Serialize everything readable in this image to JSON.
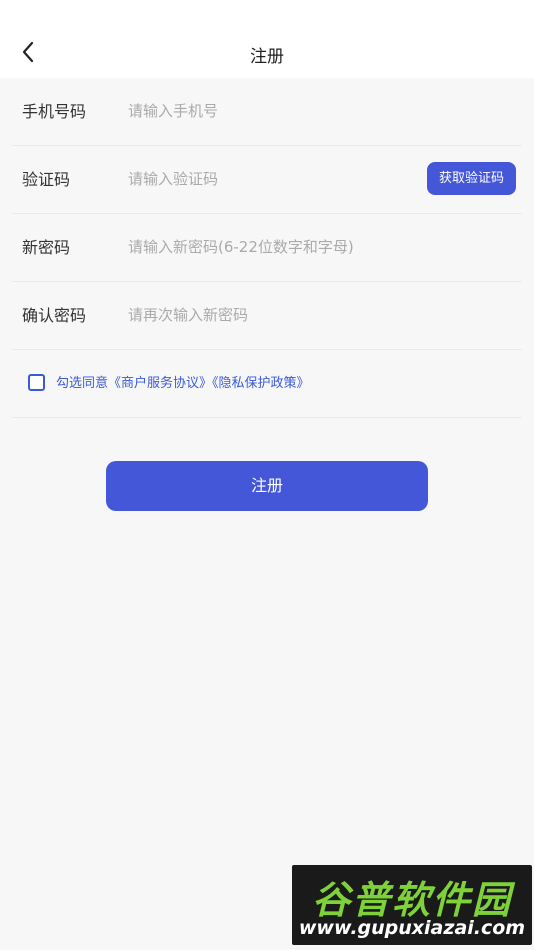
{
  "header": {
    "title": "注册",
    "back_icon": "chevron-left-icon"
  },
  "form": {
    "phone": {
      "label": "手机号码",
      "placeholder": "请输入手机号"
    },
    "code": {
      "label": "验证码",
      "placeholder": "请输入验证码",
      "button": "获取验证码"
    },
    "new_password": {
      "label": "新密码",
      "placeholder": "请输入新密码(6-22位数字和字母)"
    },
    "confirm_password": {
      "label": "确认密码",
      "placeholder": "请再次输入新密码"
    }
  },
  "agreement": {
    "checked": false,
    "prefix": "勾选同意",
    "merchant_link": "《商户服务协议》",
    "privacy_link": "《隐私保护政策》"
  },
  "submit": {
    "label": "注册"
  },
  "watermark": {
    "title": "谷普软件园",
    "url": "www.gupuxiazai.com"
  },
  "colors": {
    "accent": "#4357d8",
    "link": "#3a5bd9",
    "background": "#f7f7f7",
    "placeholder": "#aaaaaa"
  }
}
